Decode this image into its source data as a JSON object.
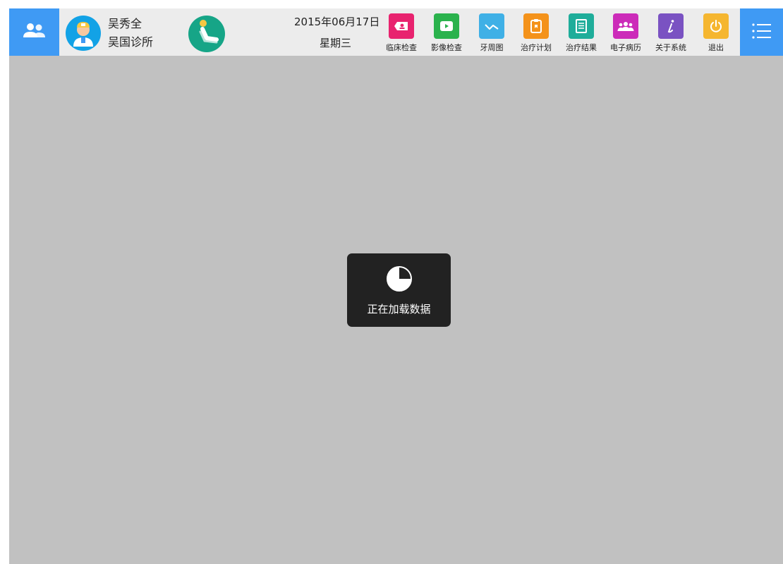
{
  "colors": {
    "accent": "#3f9af4",
    "topbar": "#ececec",
    "content": "#c1c1c1",
    "overlay": "#222222"
  },
  "header": {
    "left_icon": "users-icon",
    "avatar_icon": "doctor-avatar-icon",
    "doctor_name": "吴秀全",
    "clinic_name": "吴国诊所",
    "logo_icon": "dental-chair-icon",
    "date": "2015年06月17日",
    "weekday": "星期三",
    "menu_icon": "hamburger-menu-icon"
  },
  "toolbar": {
    "items": [
      {
        "label": "临床检查",
        "icon": "tooth-card-icon",
        "color": "#e8236f"
      },
      {
        "label": "影像检查",
        "icon": "video-play-icon",
        "color": "#2ab24c"
      },
      {
        "label": "牙周图",
        "icon": "chart-line-icon",
        "color": "#3fb0e6"
      },
      {
        "label": "治疗计划",
        "icon": "clipboard-icon",
        "color": "#f4921a"
      },
      {
        "label": "治疗结果",
        "icon": "receipt-icon",
        "color": "#1fad9a"
      },
      {
        "label": "电子病历",
        "icon": "group-icon",
        "color": "#cc2bb9"
      },
      {
        "label": "关于系统",
        "icon": "info-icon",
        "color": "#7a52c2"
      },
      {
        "label": "退出",
        "icon": "power-icon",
        "color": "#f5b630"
      }
    ]
  },
  "loading": {
    "icon": "loading-pie-icon",
    "text": "正在加载数据"
  }
}
